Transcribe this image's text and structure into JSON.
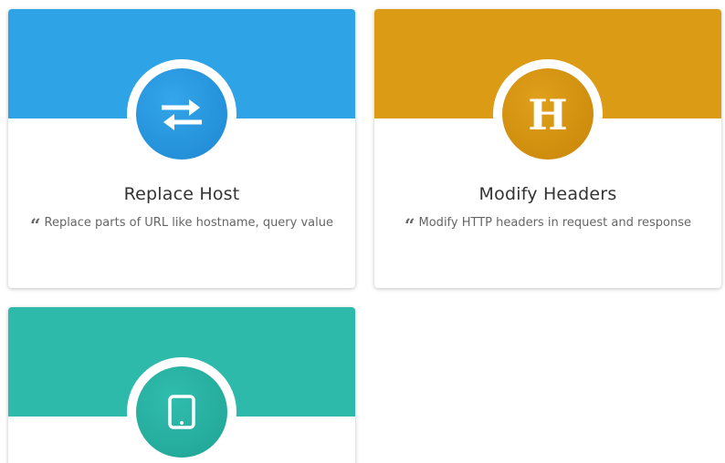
{
  "cards": [
    {
      "title": "Replace Host",
      "description": "Replace parts of URL like hostname, query value",
      "icon": "swap-arrows-icon",
      "color": "#2ea3e6",
      "badge_color": "#2390d8"
    },
    {
      "title": "Modify Headers",
      "description": "Modify HTTP headers in request and response",
      "icon": "header-h-icon",
      "icon_text": "H",
      "color": "#dc9b14",
      "badge_color": "#cc8a0c"
    },
    {
      "title": "",
      "description": "",
      "icon": "tablet-icon",
      "color": "#2dbaaa",
      "badge_color": "#23a898"
    }
  ]
}
